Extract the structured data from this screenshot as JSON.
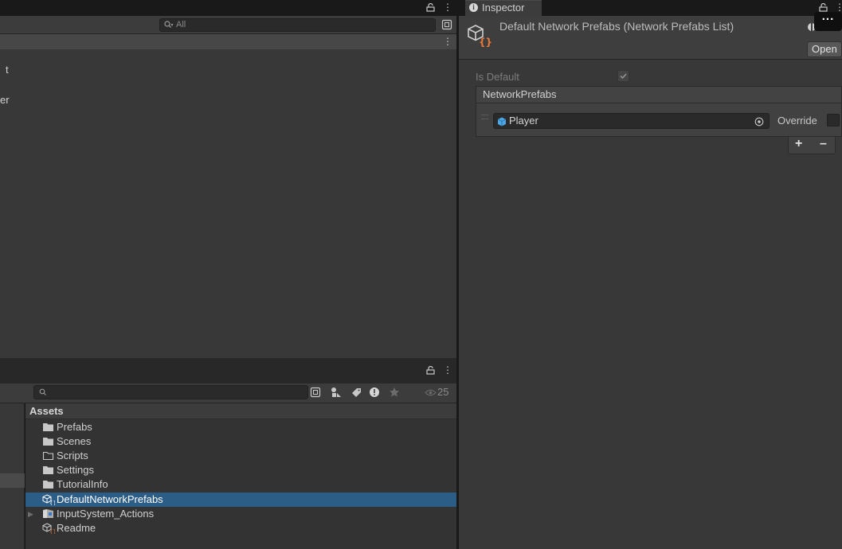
{
  "hierarchy": {
    "search_placeholder": "All",
    "partial_items": [
      "t",
      "er"
    ]
  },
  "project": {
    "assets_title": "Assets",
    "visible_count": "25",
    "items": [
      {
        "label": "Prefabs",
        "icon": "folder-filled-icon"
      },
      {
        "label": "Scenes",
        "icon": "folder-filled-icon"
      },
      {
        "label": "Scripts",
        "icon": "folder-empty-icon"
      },
      {
        "label": "Settings",
        "icon": "folder-filled-icon"
      },
      {
        "label": "TutorialInfo",
        "icon": "folder-filled-icon"
      },
      {
        "label": "DefaultNetworkPrefabs",
        "icon": "network-prefabs-asset-icon",
        "selected": true
      },
      {
        "label": "InputSystem_Actions",
        "icon": "input-actions-icon",
        "expandable": true
      },
      {
        "label": "Readme",
        "icon": "readme-asset-icon"
      }
    ]
  },
  "inspector": {
    "tab_label": "Inspector",
    "title": "Default Network Prefabs (Network Prefabs List)",
    "open_button": "Open",
    "more_button": "...",
    "is_default_label": "Is Default",
    "is_default_checked": true,
    "list_header": "NetworkPrefabs",
    "prefab_field_value": "Player",
    "override_label": "Override",
    "override_checked": false,
    "add_label": "+",
    "remove_label": "–"
  },
  "colors": {
    "selection": "#2c5d87",
    "panel_bg": "#383838",
    "prefab_cube": "#4aa6e6",
    "asset_brace": "#e87a3c"
  }
}
